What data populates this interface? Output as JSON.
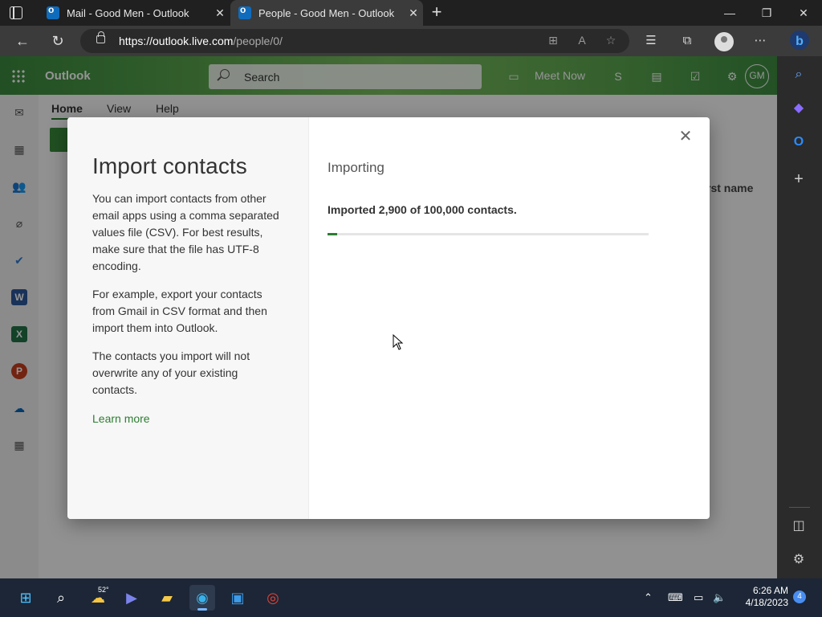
{
  "browser": {
    "tabs": [
      {
        "title": "Mail - Good Men - Outlook"
      },
      {
        "title": "People - Good Men - Outlook"
      }
    ],
    "url_host": "https://outlook.live.com",
    "url_path": "/people/0/"
  },
  "outlook": {
    "brand": "Outlook",
    "search_placeholder": "Search",
    "meet_now": "Meet Now",
    "avatar_initials": "GM",
    "ribbon_tabs": [
      "Home",
      "View",
      "Help"
    ],
    "column_header": "rst name"
  },
  "dialog": {
    "title": "Import contacts",
    "paragraphs": [
      "You can import contacts from other email apps using a comma separated values file (CSV). For best results, make sure that the file has UTF-8 encoding.",
      "For example, export your contacts from Gmail in CSV format and then import them into Outlook.",
      "The contacts you import will not overwrite any of your existing contacts."
    ],
    "learn_more": "Learn more",
    "status_title": "Importing",
    "status_message": "Imported 2,900 of 100,000 contacts.",
    "progress_fraction": 0.029
  },
  "taskbar": {
    "weather_temp": "52°",
    "time": "6:26 AM",
    "date": "4/18/2023",
    "notification_count": "4"
  },
  "colors": {
    "accent_green": "#2e7d32",
    "outlook_header": "#4f9e46"
  }
}
